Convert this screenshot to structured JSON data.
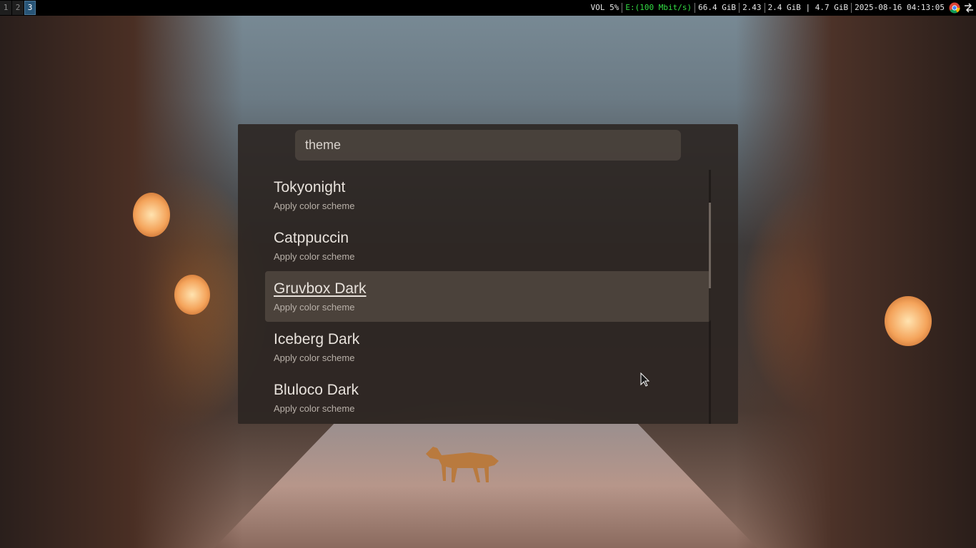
{
  "topbar": {
    "workspaces": [
      {
        "label": "1",
        "active": false
      },
      {
        "label": "2",
        "active": false
      },
      {
        "label": "3",
        "active": true
      }
    ],
    "volume": "VOL 5%",
    "ethernet": "E:(100 Mbit/s)",
    "disk": "66.4 GiB",
    "load": "2.43",
    "memory": "2.4 GiB | 4.7 GiB",
    "datetime": "2025-08-16 04:13:05",
    "tray_icons": [
      "chrome-icon",
      "network-arrows-icon"
    ]
  },
  "launcher": {
    "search": {
      "value": "theme"
    },
    "results": [
      {
        "title": "Tokyonight",
        "subtitle": "Apply color scheme",
        "selected": false
      },
      {
        "title": "Catppuccin",
        "subtitle": "Apply color scheme",
        "selected": false
      },
      {
        "title": "Gruvbox Dark",
        "subtitle": "Apply color scheme",
        "selected": true
      },
      {
        "title": "Iceberg Dark",
        "subtitle": "Apply color scheme",
        "selected": false
      },
      {
        "title": "Bluloco Dark",
        "subtitle": "Apply color scheme",
        "selected": false
      }
    ]
  },
  "colors": {
    "topbar_bg": "#000000",
    "active_workspace": "#285577",
    "ethernet_status": "#33dd44",
    "launcher_bg": "#2c2622",
    "selected_item_bg": "#584e46"
  }
}
